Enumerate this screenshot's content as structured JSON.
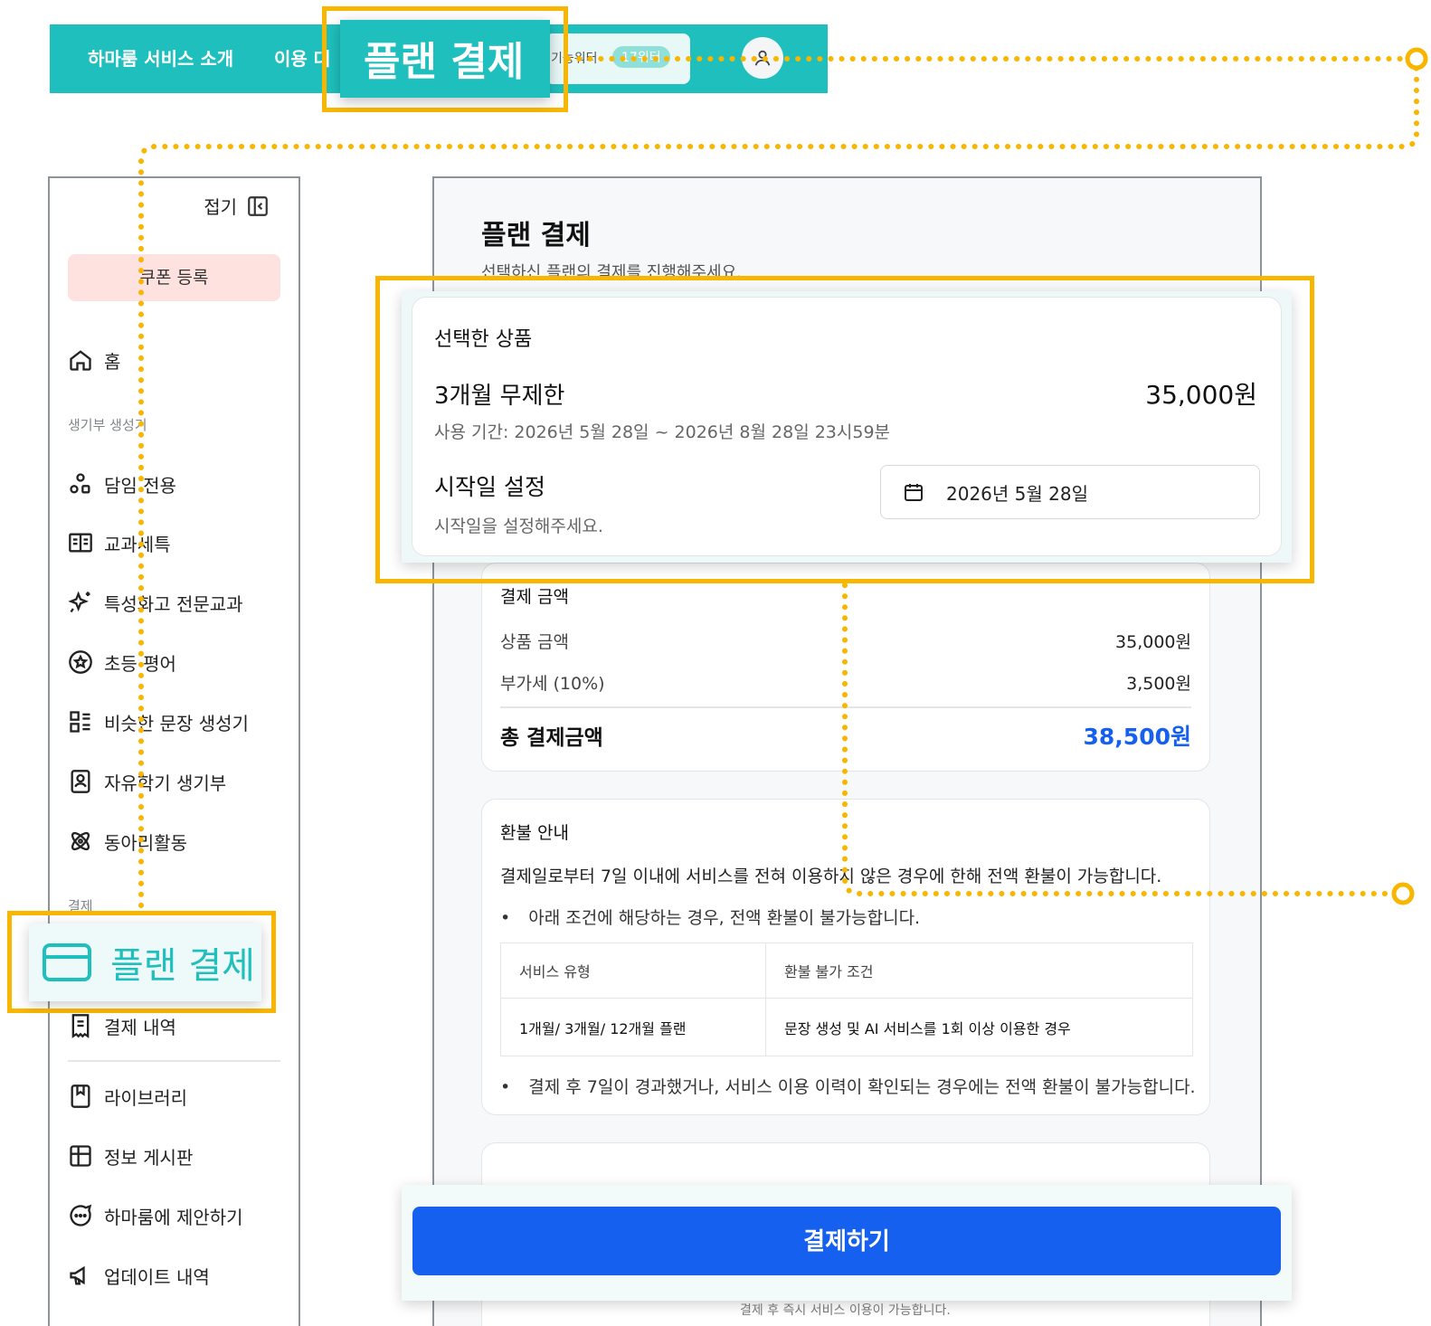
{
  "topnav": {
    "items": [
      "하마룸 서비스 소개",
      "이용 대"
    ],
    "pill_text": "기능워터",
    "pill_badge": "17워터"
  },
  "callouts": {
    "top_label": "플랜 결제",
    "side_label": "플랜 결제"
  },
  "sidebar": {
    "collapse_label": "접기",
    "coupon_label": "쿠폰 등록",
    "home_label": "홈",
    "section_generator": "생기부 생성기",
    "generator_items": [
      {
        "label": "담임 전용",
        "icon": "users-icon"
      },
      {
        "label": "교과세특",
        "icon": "book-icon"
      },
      {
        "label": "특성화고 전문교과",
        "icon": "sparkles-icon"
      },
      {
        "label": "초등 평어",
        "icon": "badge-icon"
      },
      {
        "label": "비슷한 문장 생성기",
        "icon": "list-icon"
      },
      {
        "label": "자유학기 생기부",
        "icon": "id-card-icon"
      },
      {
        "label": "동아리활동",
        "icon": "atom-icon"
      }
    ],
    "section_payment": "결제",
    "payment_items": [
      {
        "label": "결제 내역",
        "icon": "receipt-icon"
      }
    ],
    "other_items": [
      {
        "label": "라이브러리",
        "icon": "bookmark-icon"
      },
      {
        "label": "정보 게시판",
        "icon": "board-icon"
      },
      {
        "label": "하마룸에 제안하기",
        "icon": "chat-icon"
      },
      {
        "label": "업데이트 내역",
        "icon": "megaphone-icon"
      }
    ]
  },
  "main": {
    "title": "플랜 결제",
    "subtitle": "선택하신 플랜의 결제를 진행해주세요.",
    "product": {
      "heading": "선택한 상품",
      "plan_name": "3개월 무제한",
      "price": "35,000원",
      "period": "사용 기간: 2026년 5월 28일 ~ 2026년 8월 28일 23시59분",
      "start_label": "시작일 설정",
      "start_hint": "시작일을 설정해주세요.",
      "start_date": "2026년 5월 28일"
    },
    "payment": {
      "heading": "결제 금액",
      "rows": [
        {
          "label": "상품 금액",
          "value": "35,000원"
        },
        {
          "label": "부가세 (10%)",
          "value": "3,500원"
        }
      ],
      "total_label": "총 결제금액",
      "total_value": "38,500원",
      "total_color": "#1660f0"
    },
    "refund": {
      "heading": "환불 안내",
      "line": "결제일로부터 7일 이내에 서비스를 전혀 이용하지 않은 경우에 한해 전액 환불이 가능합니다.",
      "bullet1": "아래 조건에 해당하는 경우, 전액 환불이 불가능합니다.",
      "table_headers": [
        "서비스 유형",
        "환불 불가 조건"
      ],
      "table_row": [
        "1개월/ 3개월/ 12개월 플랜",
        "문장 생성 및 AI 서비스를 1회 이상 이용한 경우"
      ],
      "bullet2": "결제 후 7일이 경과했거나, 서비스 이용 이력이 확인되는 경우에는 전액 환불이 불가능합니다."
    },
    "pay_button": "결제하기",
    "footnote": "결제 후 즉시 서비스 이용이 가능합니다."
  },
  "colors": {
    "brand_teal": "#1fbfbd",
    "accent_blue": "#1660f0",
    "callout_yellow": "#f8b600"
  }
}
